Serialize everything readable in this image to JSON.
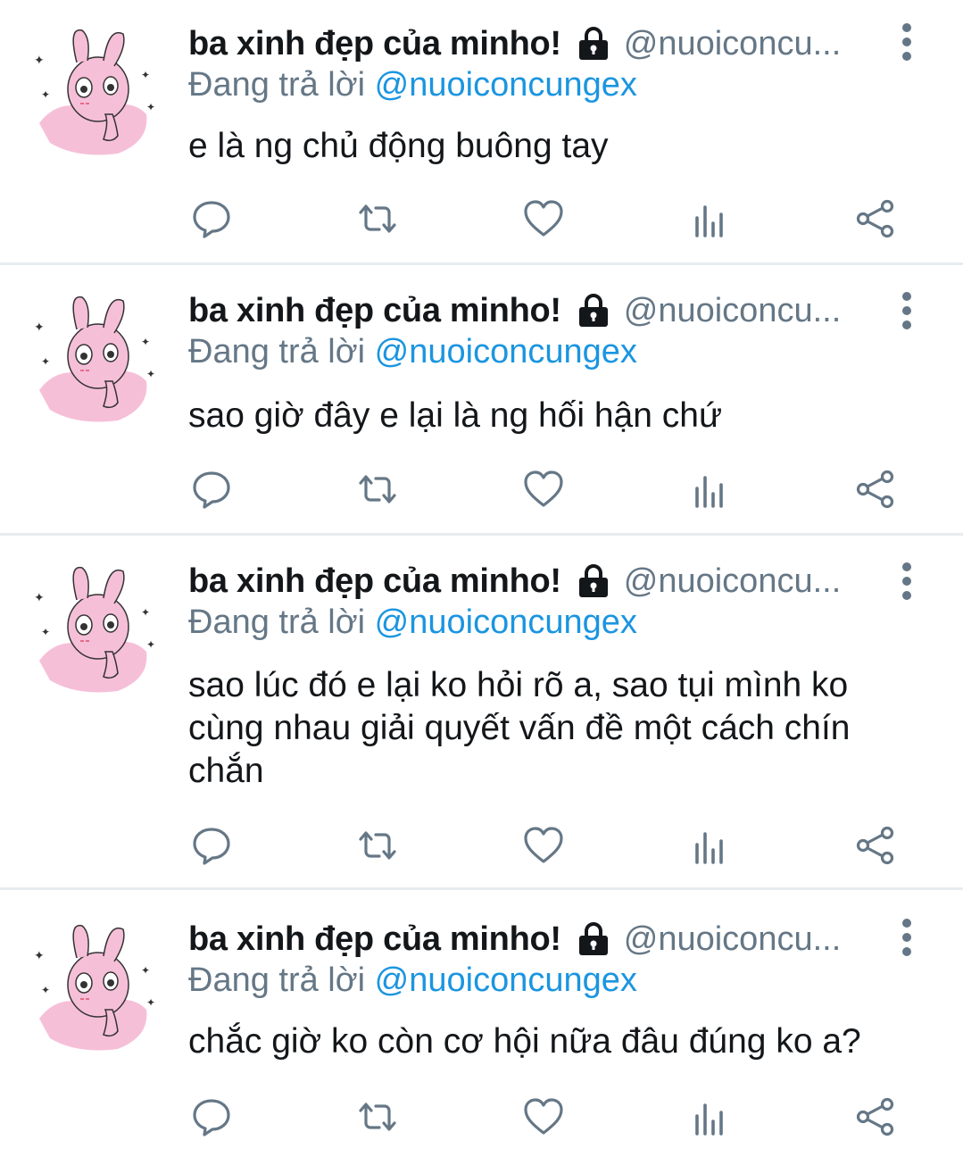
{
  "tweets": [
    {
      "name": "ba xinh đẹp của minho!",
      "handle": "@nuoiconcu...",
      "replying_prefix": "Đang trả lời",
      "replying_to": "@nuoiconcungex",
      "text": "e là ng chủ động buông tay"
    },
    {
      "name": "ba xinh đẹp của minho!",
      "handle": "@nuoiconcu...",
      "replying_prefix": "Đang trả lời",
      "replying_to": "@nuoiconcungex",
      "text": "sao giờ đây e lại là ng hối hận chứ"
    },
    {
      "name": "ba xinh đẹp của minho!",
      "handle": "@nuoiconcu...",
      "replying_prefix": "Đang trả lời",
      "replying_to": "@nuoiconcungex",
      "text": "sao lúc đó e lại ko hỏi rõ a, sao tụi mình ko cùng nhau giải quyết vấn đề một cách chín chắn"
    },
    {
      "name": "ba xinh đẹp của minho!",
      "handle": "@nuoiconcu...",
      "replying_prefix": "Đang trả lời",
      "replying_to": "@nuoiconcungex",
      "text": "chắc giờ ko còn cơ hội nữa đâu đúng ko a?"
    }
  ],
  "icons": {
    "lock": "lock-icon",
    "more": "more-vertical-icon",
    "reply": "reply-icon",
    "retweet": "retweet-icon",
    "like": "heart-icon",
    "analytics": "analytics-icon",
    "share": "share-icon"
  },
  "colors": {
    "text": "#14171a",
    "secondary": "#657786",
    "link": "#1b95e0",
    "divider": "#e6ecf0",
    "avatar_pink": "#f6bfd8"
  }
}
